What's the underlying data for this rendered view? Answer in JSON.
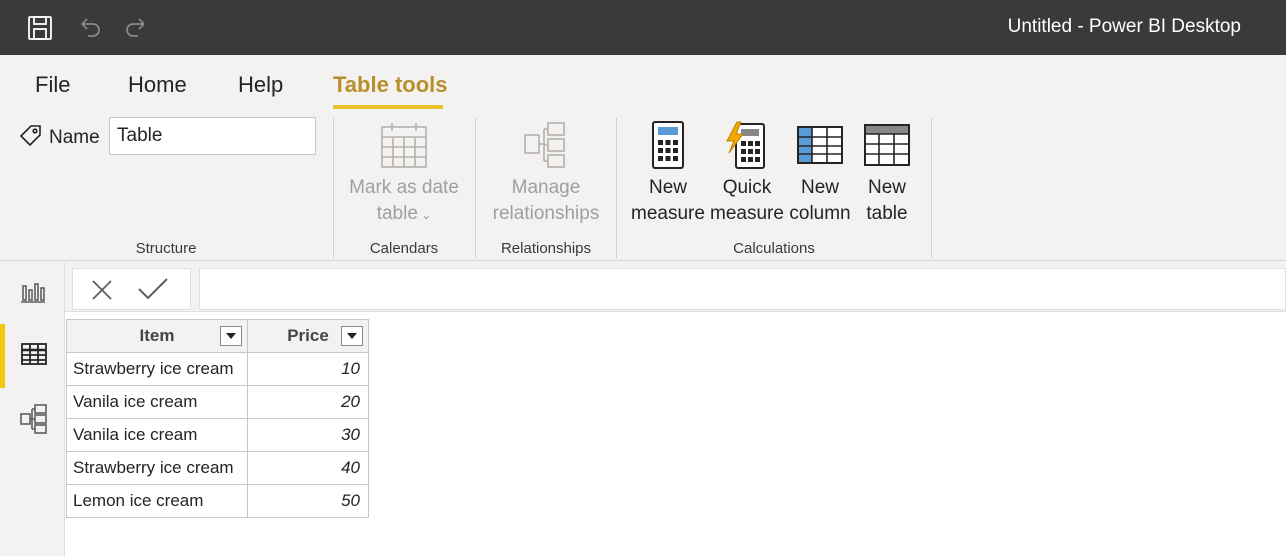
{
  "app": {
    "title": "Untitled - Power BI Desktop"
  },
  "titlebar": {
    "icons": [
      "save-icon",
      "undo-icon",
      "redo-icon"
    ]
  },
  "ribbon": {
    "tabs": [
      {
        "label": "File",
        "active": false
      },
      {
        "label": "Home",
        "active": false
      },
      {
        "label": "Help",
        "active": false
      },
      {
        "label": "Table tools",
        "active": true
      }
    ],
    "structure": {
      "name_label": "Name",
      "name_value": "Table",
      "group_label": "Structure"
    },
    "calendars": {
      "button_line1": "Mark as date",
      "button_line2": "table",
      "group_label": "Calendars"
    },
    "relationships": {
      "button_line1": "Manage",
      "button_line2": "relationships",
      "group_label": "Relationships"
    },
    "calculations": {
      "group_label": "Calculations",
      "buttons": [
        {
          "line1": "New",
          "line2": "measure",
          "icon": "calculator-icon"
        },
        {
          "line1": "Quick",
          "line2": "measure",
          "icon": "quick-measure-icon"
        },
        {
          "line1": "New",
          "line2": "column",
          "icon": "new-column-icon"
        },
        {
          "line1": "New",
          "line2": "table",
          "icon": "new-table-icon"
        }
      ]
    }
  },
  "nav": {
    "items": [
      "report-view-icon",
      "data-view-icon",
      "model-view-icon"
    ],
    "active": "data-view-icon"
  },
  "colors": {
    "accent": "#f2c811",
    "active_tab": "#b8902a",
    "titlebar": "#3b3a39"
  },
  "table": {
    "columns": [
      "Item",
      "Price"
    ],
    "rows": [
      [
        "Strawberry ice cream",
        "10"
      ],
      [
        "Vanila ice cream",
        "20"
      ],
      [
        "Vanila ice cream",
        "30"
      ],
      [
        "Strawberry ice cream",
        "40"
      ],
      [
        "Lemon ice cream",
        "50"
      ]
    ]
  }
}
